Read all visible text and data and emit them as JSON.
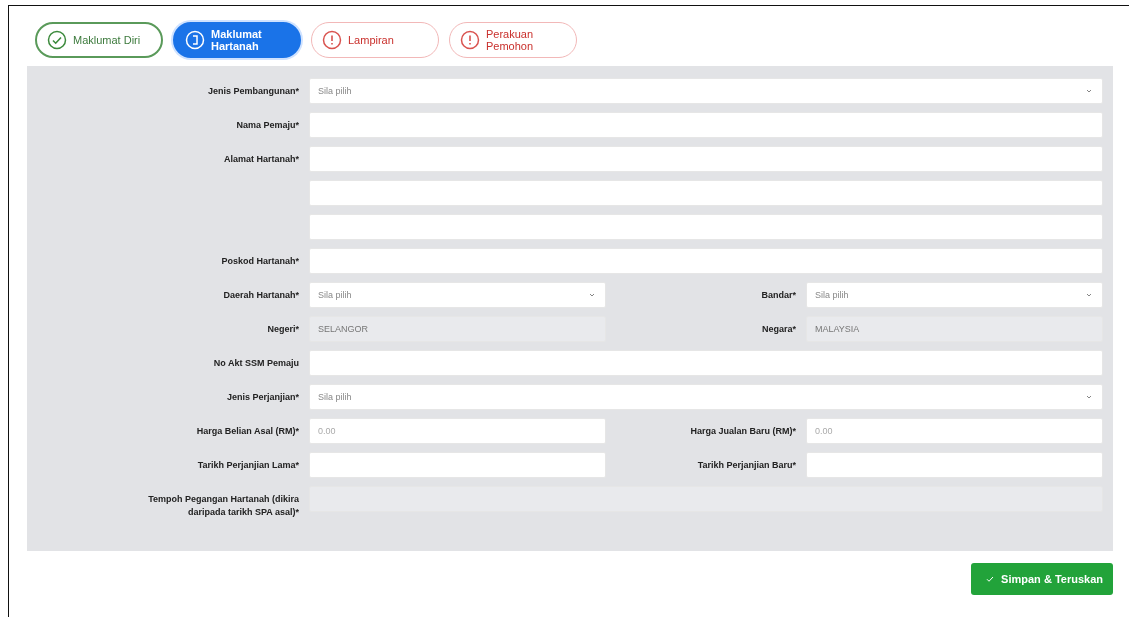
{
  "steps": [
    {
      "label": "Maklumat Diri",
      "kind": "done",
      "selected": false
    },
    {
      "label": "Maklumat Hartanah",
      "kind": "current",
      "selected": true
    },
    {
      "label": "Lampiran",
      "kind": "pending",
      "selected": false
    },
    {
      "label": "Perakuan Pemohon",
      "kind": "pending",
      "selected": false
    }
  ],
  "form": {
    "rows": [
      {
        "cells": [
          {
            "label": "Jenis Pembangunan*",
            "controls": [
              {
                "kind": "select",
                "value": "Sila pilih"
              }
            ]
          }
        ]
      },
      {
        "cells": [
          {
            "label": "Nama Pemaju*",
            "controls": [
              {
                "kind": "text"
              }
            ]
          }
        ]
      },
      {
        "cells": [
          {
            "label": "Alamat Hartanah*",
            "controls": [
              {
                "kind": "text"
              },
              {
                "kind": "text"
              },
              {
                "kind": "text"
              }
            ]
          }
        ]
      },
      {
        "cells": [
          {
            "label": "Poskod Hartanah*",
            "controls": [
              {
                "kind": "text"
              }
            ]
          }
        ]
      },
      {
        "cells": [
          {
            "label": "Daerah Hartanah*",
            "controls": [
              {
                "kind": "select",
                "value": "Sila pilih"
              }
            ]
          },
          {
            "label": "Bandar*",
            "controls": [
              {
                "kind": "select",
                "value": "Sila pilih"
              }
            ]
          }
        ]
      },
      {
        "cells": [
          {
            "label": "Negeri*",
            "controls": [
              {
                "kind": "readonly",
                "value": "SELANGOR"
              }
            ]
          },
          {
            "label": "Negara*",
            "controls": [
              {
                "kind": "readonly",
                "value": "MALAYSIA"
              }
            ]
          }
        ]
      },
      {
        "cells": [
          {
            "label": "No Akt SSM Pemaju",
            "controls": [
              {
                "kind": "text"
              }
            ]
          }
        ]
      },
      {
        "cells": [
          {
            "label": "Jenis Perjanjian*",
            "controls": [
              {
                "kind": "select",
                "value": "Sila pilih"
              }
            ]
          }
        ]
      },
      {
        "cells": [
          {
            "label": "Harga Belian Asal (RM)*",
            "controls": [
              {
                "kind": "text",
                "placeholder": "0.00"
              }
            ]
          },
          {
            "label": "Harga Jualan Baru (RM)*",
            "controls": [
              {
                "kind": "text",
                "placeholder": "0.00"
              }
            ]
          }
        ]
      },
      {
        "cells": [
          {
            "label": "Tarikh Perjanjian Lama*",
            "controls": [
              {
                "kind": "text"
              }
            ]
          },
          {
            "label": "Tarikh Perjanjian Baru*",
            "controls": [
              {
                "kind": "text"
              }
            ]
          }
        ]
      },
      {
        "cells": [
          {
            "label": "Tempoh Pegangan Hartanah (dikira daripada tarikh SPA asal)*",
            "controls": [
              {
                "kind": "readonly"
              }
            ]
          }
        ]
      }
    ]
  },
  "submit_button": {
    "label": "Simpan & Teruskan"
  }
}
